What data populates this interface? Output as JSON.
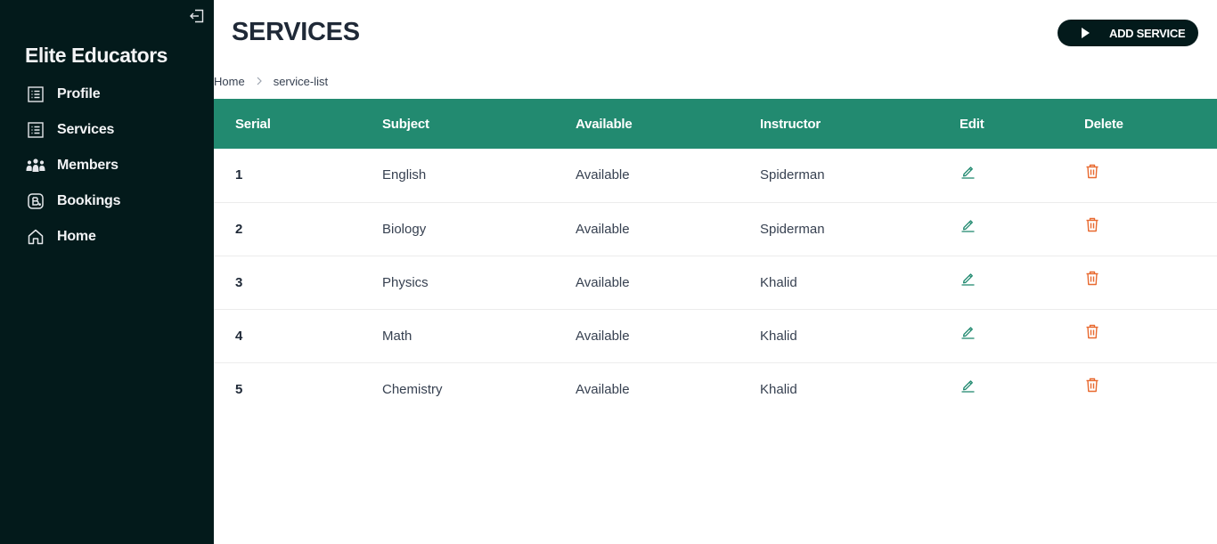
{
  "sidebar": {
    "brand": "Elite Educators",
    "items": [
      {
        "label": "Profile",
        "icon": "list-icon"
      },
      {
        "label": "Services",
        "icon": "list-icon"
      },
      {
        "label": "Members",
        "icon": "people-icon"
      },
      {
        "label": "Bookings",
        "icon": "booking-icon"
      },
      {
        "label": "Home",
        "icon": "home-icon"
      }
    ]
  },
  "header": {
    "title": "SERVICES",
    "add_button_label": "ADD SERVICE"
  },
  "breadcrumb": {
    "home": "Home",
    "current": "service-list"
  },
  "table": {
    "columns": [
      "Serial",
      "Subject",
      "Available",
      "Instructor",
      "Edit",
      "Delete"
    ],
    "rows": [
      {
        "serial": "1",
        "subject": "English",
        "available": "Available",
        "instructor": "Spiderman"
      },
      {
        "serial": "2",
        "subject": "Biology",
        "available": "Available",
        "instructor": "Spiderman"
      },
      {
        "serial": "3",
        "subject": "Physics",
        "available": "Available",
        "instructor": "Khalid"
      },
      {
        "serial": "4",
        "subject": "Math",
        "available": "Available",
        "instructor": "Khalid"
      },
      {
        "serial": "5",
        "subject": "Chemistry",
        "available": "Available",
        "instructor": "Khalid"
      }
    ]
  },
  "colors": {
    "sidebar_bg": "#031a1b",
    "header_bg": "#228a70",
    "edit_icon": "#228a70",
    "delete_icon": "#e8692f"
  }
}
